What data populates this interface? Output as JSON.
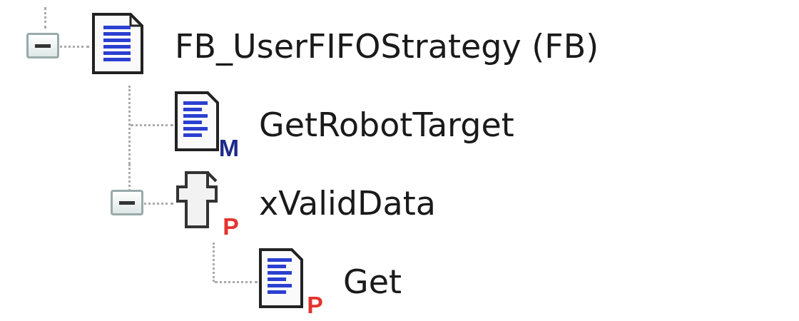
{
  "tree": [
    {
      "label": "FB_UserFIFOStrategy (FB)",
      "kind": "function_block",
      "expanded": true,
      "children": [
        {
          "label": "GetRobotTarget",
          "kind": "method",
          "badge": "M"
        },
        {
          "label": "xValidData",
          "kind": "property",
          "badge": "P",
          "expanded": true,
          "children": [
            {
              "label": "Get",
              "kind": "accessor",
              "badge": "P"
            }
          ]
        }
      ]
    }
  ]
}
